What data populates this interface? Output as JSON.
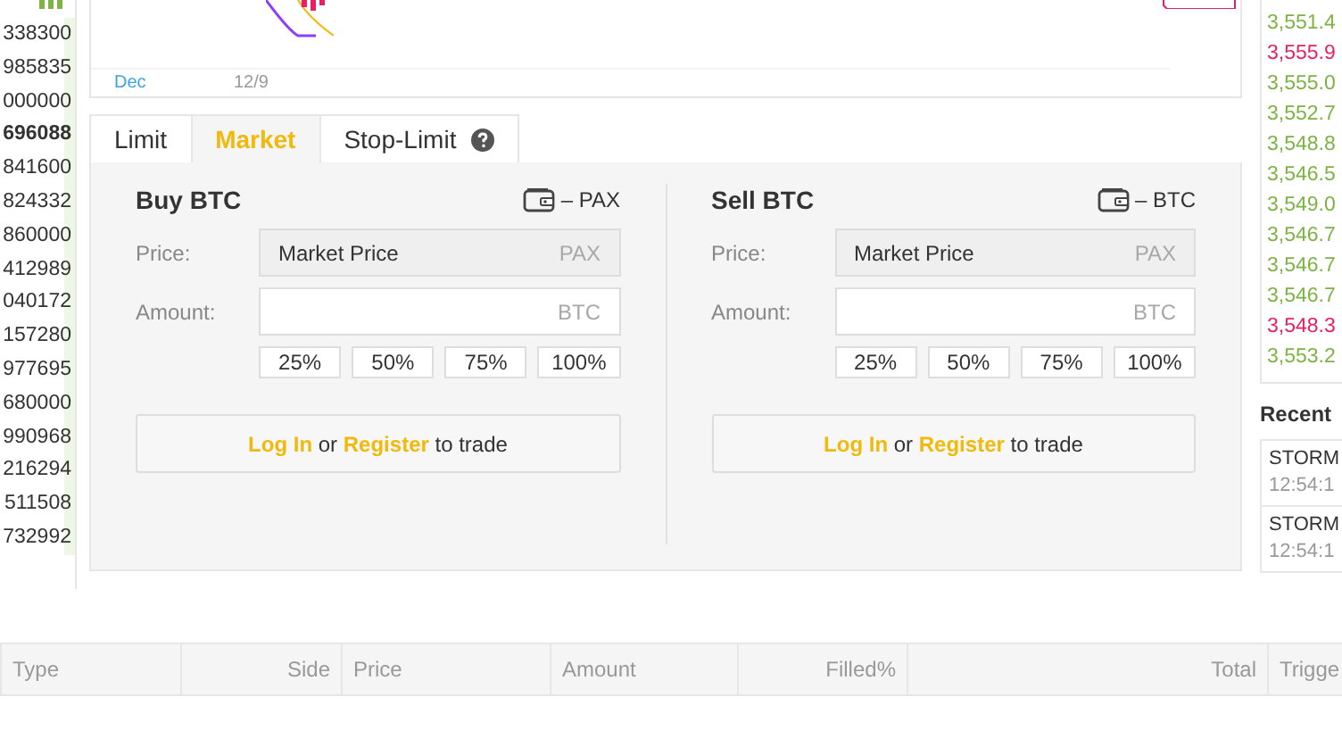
{
  "order_book": {
    "rows": [
      {
        "amount": "338300",
        "highlighted": false
      },
      {
        "amount": "985835",
        "highlighted": false
      },
      {
        "amount": "000000",
        "highlighted": false
      },
      {
        "amount": "696088",
        "highlighted": true
      },
      {
        "amount": "841600",
        "highlighted": false
      },
      {
        "amount": "824332",
        "highlighted": false
      },
      {
        "amount": "860000",
        "highlighted": false
      },
      {
        "amount": "412989",
        "highlighted": false
      },
      {
        "amount": "040172",
        "highlighted": false
      },
      {
        "amount": "157280",
        "highlighted": false
      },
      {
        "amount": "977695",
        "highlighted": false
      },
      {
        "amount": "680000",
        "highlighted": false
      },
      {
        "amount": "990968",
        "highlighted": false
      },
      {
        "amount": "216294",
        "highlighted": false
      },
      {
        "amount": "511508",
        "highlighted": false
      },
      {
        "amount": "732992",
        "highlighted": false
      }
    ]
  },
  "chart": {
    "x_labels": [
      "Dec",
      "12/9"
    ]
  },
  "order_tabs": [
    {
      "label": "Limit",
      "selected": false,
      "help": false
    },
    {
      "label": "Market",
      "selected": true,
      "help": false
    },
    {
      "label": "Stop-Limit",
      "selected": false,
      "help": true
    }
  ],
  "forms": [
    {
      "title": "Buy BTC",
      "balance": "– PAX",
      "price_label": "Price:",
      "price_value": "Market Price",
      "price_unit": "PAX",
      "amount_label": "Amount:",
      "amount_unit": "BTC",
      "percents": [
        "25%",
        "50%",
        "75%",
        "100%"
      ],
      "login": "Log In",
      "or": "or",
      "register": "Register",
      "trade": "to trade"
    },
    {
      "title": "Sell BTC",
      "balance": "– BTC",
      "price_label": "Price:",
      "price_value": "Market Price",
      "price_unit": "PAX",
      "amount_label": "Amount:",
      "amount_unit": "BTC",
      "percents": [
        "25%",
        "50%",
        "75%",
        "100%"
      ],
      "login": "Log In",
      "or": "or",
      "register": "Register",
      "trade": "to trade"
    }
  ],
  "trades": [
    {
      "price": "3,551.4",
      "color": "#7cb342"
    },
    {
      "price": "3,555.9",
      "color": "#e91e63"
    },
    {
      "price": "3,555.0",
      "color": "#7cb342"
    },
    {
      "price": "3,552.7",
      "color": "#7cb342"
    },
    {
      "price": "3,548.8",
      "color": "#7cb342"
    },
    {
      "price": "3,546.5",
      "color": "#7cb342"
    },
    {
      "price": "3,549.0",
      "color": "#7cb342"
    },
    {
      "price": "3,546.7",
      "color": "#7cb342"
    },
    {
      "price": "3,546.7",
      "color": "#7cb342"
    },
    {
      "price": "3,546.7",
      "color": "#7cb342"
    },
    {
      "price": "3,548.3",
      "color": "#e91e63"
    },
    {
      "price": "3,553.2",
      "color": "#7cb342"
    }
  ],
  "recent": {
    "title": "Recent",
    "rows": [
      {
        "name": "STORM",
        "time": "12:54:1"
      },
      {
        "name": "STORM",
        "time": "12:54:1"
      }
    ]
  },
  "orders_table": {
    "columns": [
      {
        "label": "Type"
      },
      {
        "label": "Side"
      },
      {
        "label": "Price"
      },
      {
        "label": "Amount"
      },
      {
        "label": "Filled%"
      },
      {
        "label": "Total"
      },
      {
        "label": "Trigge"
      }
    ]
  }
}
